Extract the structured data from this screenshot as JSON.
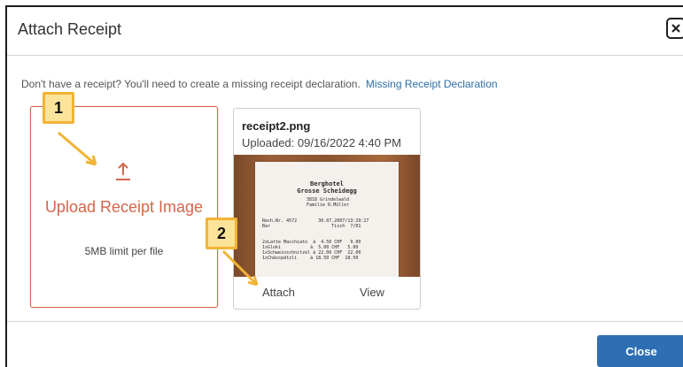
{
  "dialog": {
    "title": "Attach Receipt",
    "close_icon": "close-x-icon",
    "notice_text": "Don't have a receipt? You'll need to create a missing receipt declaration.",
    "notice_link": "Missing Receipt Declaration",
    "close_button": "Close"
  },
  "upload": {
    "icon": "upload-arrow-icon",
    "title": "Upload Receipt Image",
    "limit": "5MB limit per file"
  },
  "receipt": {
    "file_name": "receipt2.png",
    "uploaded": "Uploaded: 09/16/2022 4:40 PM",
    "attach_label": "Attach",
    "view_label": "View"
  },
  "callouts": {
    "one": "1",
    "two": "2"
  },
  "colors": {
    "accent": "#d2664a",
    "primary_button": "#2e6fb3",
    "link": "#2d6fa8",
    "callout_fill": "#fbe39a",
    "callout_border": "#f2b336"
  }
}
